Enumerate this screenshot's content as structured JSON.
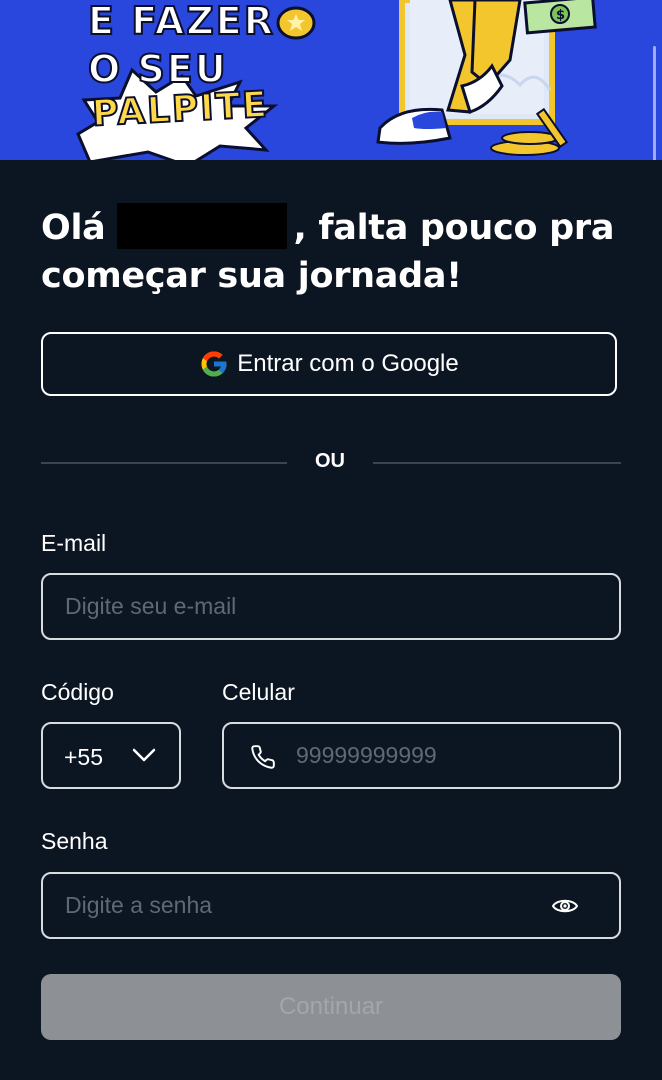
{
  "banner": {
    "line1": "E FAZER",
    "line2": "O SEU",
    "line3": "PALPITE"
  },
  "heading": {
    "prefix": "Olá",
    "suffix": ", falta pouco pra começar sua jornada!"
  },
  "google_button": {
    "label": "Entrar com o Google"
  },
  "divider": {
    "text": "OU"
  },
  "form": {
    "email": {
      "label": "E-mail",
      "placeholder": "Digite seu e-mail"
    },
    "code": {
      "label": "Código",
      "value": "+55"
    },
    "phone": {
      "label": "Celular",
      "placeholder": "99999999999"
    },
    "password": {
      "label": "Senha",
      "placeholder": "Digite a senha"
    },
    "submit": {
      "label": "Continuar"
    }
  },
  "icons": {
    "google": "google-logo-icon",
    "chevron": "chevron-down-icon",
    "phone": "phone-icon",
    "eye": "eye-icon"
  },
  "colors": {
    "banner_bg": "#2a47dd",
    "page_bg": "#0c1522",
    "accent_yellow": "#ffd84a",
    "button_disabled": "#8d9196"
  }
}
